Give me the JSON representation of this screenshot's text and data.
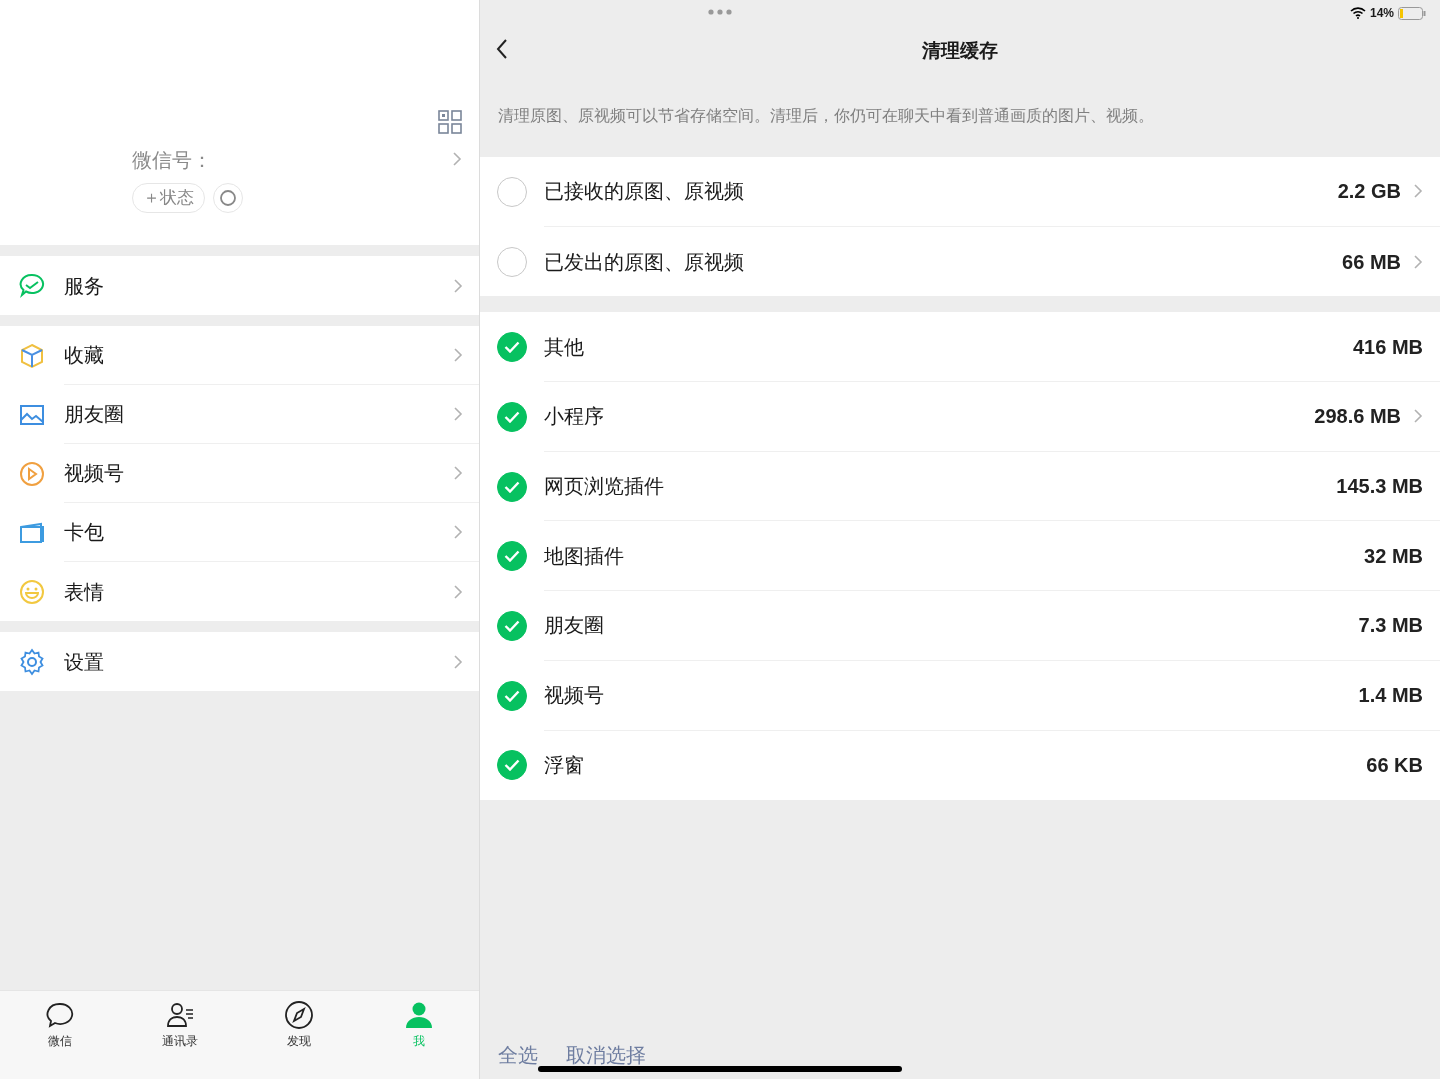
{
  "profile": {
    "wechat_id_label": "微信号：",
    "status_button": "＋状态"
  },
  "menu_groups": [
    [
      {
        "label": "服务"
      }
    ],
    [
      {
        "label": "收藏"
      },
      {
        "label": "朋友圈"
      },
      {
        "label": "视频号"
      },
      {
        "label": "卡包"
      },
      {
        "label": "表情"
      }
    ],
    [
      {
        "label": "设置"
      }
    ]
  ],
  "tab_bar": [
    {
      "label": "微信",
      "selected": false
    },
    {
      "label": "通讯录",
      "selected": false
    },
    {
      "label": "发现",
      "selected": false
    },
    {
      "label": "我",
      "selected": true
    }
  ],
  "status_bar": {
    "battery": "14%"
  },
  "nav": {
    "title": "清理缓存"
  },
  "description": "清理原图、原视频可以节省存储空间。清理后，你仍可在聊天中看到普通画质的图片、视频。",
  "cache_groups": [
    [
      {
        "label": "已接收的原图、原视频",
        "size": "2.2 GB",
        "checked": false,
        "chevron": true
      },
      {
        "label": "已发出的原图、原视频",
        "size": "66 MB",
        "checked": false,
        "chevron": true
      }
    ],
    [
      {
        "label": "其他",
        "size": "416 MB",
        "checked": true,
        "chevron": false
      },
      {
        "label": "小程序",
        "size": "298.6 MB",
        "checked": true,
        "chevron": true
      },
      {
        "label": "网页浏览插件",
        "size": "145.3 MB",
        "checked": true,
        "chevron": false
      },
      {
        "label": "地图插件",
        "size": "32 MB",
        "checked": true,
        "chevron": false
      },
      {
        "label": "朋友圈",
        "size": "7.3 MB",
        "checked": true,
        "chevron": false
      },
      {
        "label": "视频号",
        "size": "1.4 MB",
        "checked": true,
        "chevron": false
      },
      {
        "label": "浮窗",
        "size": "66 KB",
        "checked": true,
        "chevron": false
      }
    ]
  ],
  "footer_actions": [
    "全选",
    "取消选择"
  ]
}
